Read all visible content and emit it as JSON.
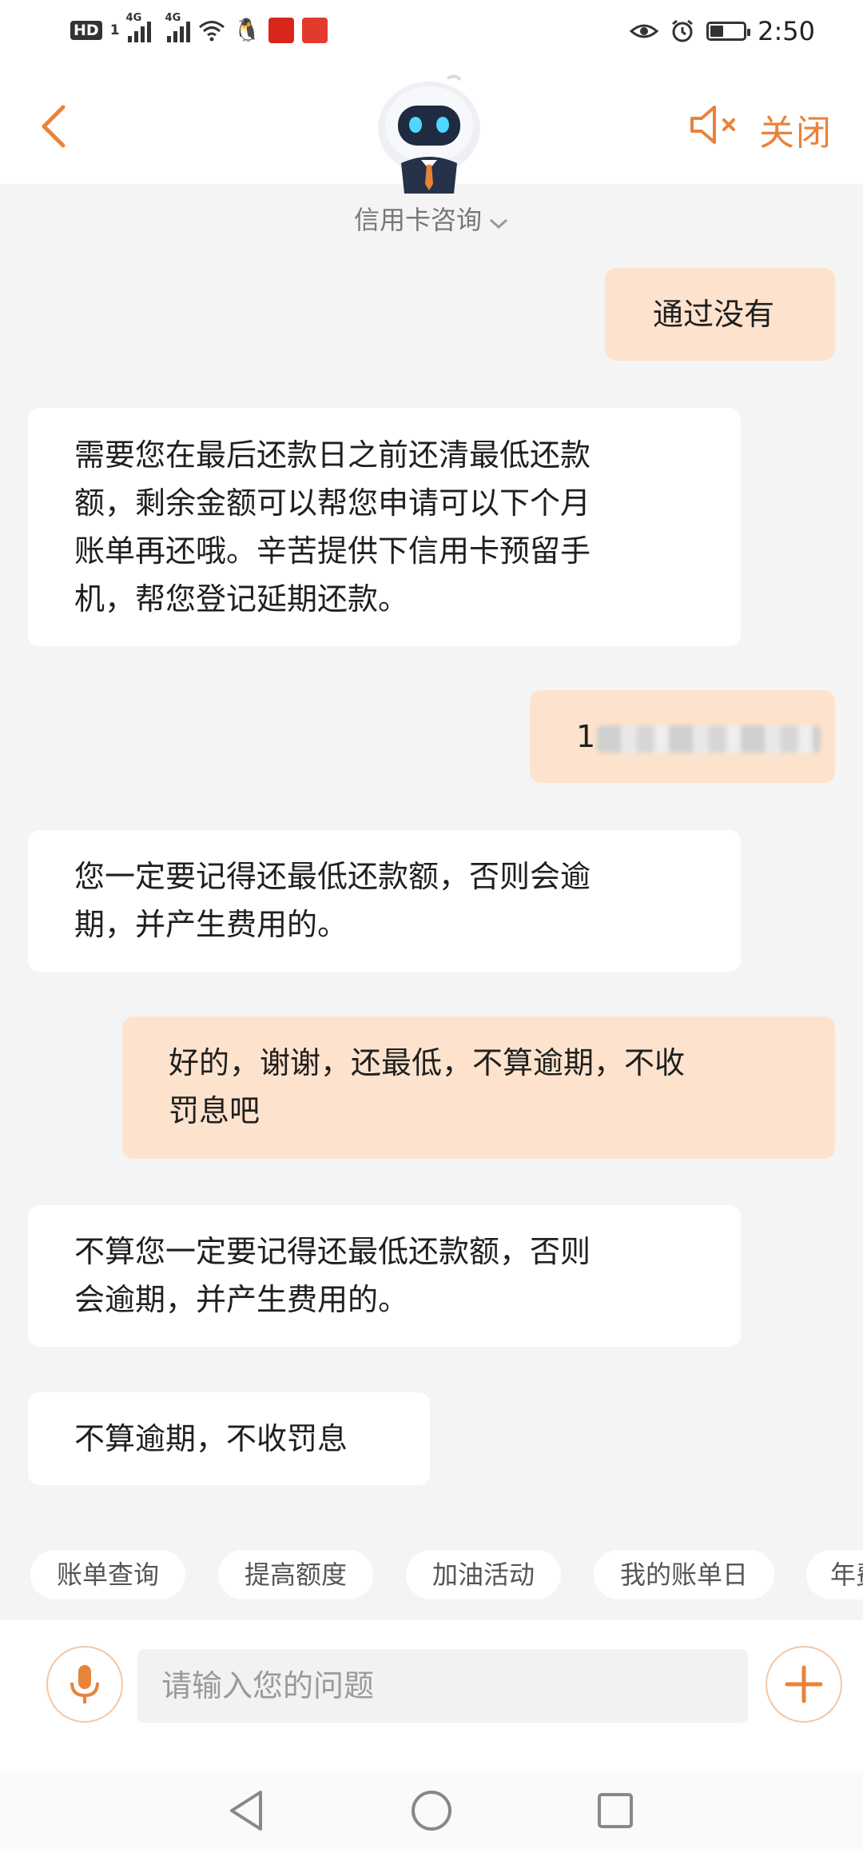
{
  "status_bar": {
    "hd_label": "HD",
    "hd_sub": "1",
    "signal_1_tag": "4G",
    "signal_2_tag": "4G",
    "time": "2:50",
    "battery_fraction": 0.4
  },
  "header": {
    "close_label": "关闭",
    "service_title": "信用卡咨询"
  },
  "messages": [
    {
      "from": "user",
      "text": "通过没有"
    },
    {
      "from": "bot",
      "lines": [
        "需要您在最后还款日之前还清最低还款",
        "额，剩余金额可以帮您申请可以下个月",
        "账单再还哦。辛苦提供下信用卡预留手",
        "机，帮您登记延期还款。"
      ]
    },
    {
      "from": "user",
      "text": "1"
    },
    {
      "from": "bot",
      "lines": [
        "您一定要记得还最低还款额，否则会逾",
        "期，并产生费用的。"
      ]
    },
    {
      "from": "user",
      "lines": [
        "好的，谢谢，还最低，不算逾期，不收",
        "罚息吧"
      ]
    },
    {
      "from": "bot",
      "lines": [
        "不算您一定要记得还最低还款额，否则",
        "会逾期，并产生费用的。"
      ]
    },
    {
      "from": "bot",
      "text": "不算逾期，不收罚息"
    }
  ],
  "quick_replies": [
    "账单查询",
    "提高额度",
    "加油活动",
    "我的账单日",
    "年费"
  ],
  "input": {
    "placeholder": "请输入您的问题",
    "value": ""
  },
  "colors": {
    "accent": "#e8833a",
    "user_bubble": "#fde3cd",
    "bot_bubble": "#ffffff",
    "background": "#f4f4f4"
  },
  "icons": {
    "back": "chevron-left-icon",
    "mute": "speaker-mute-icon",
    "avatar": "robot-avatar",
    "dropdown": "chevron-down-icon",
    "mic": "microphone-icon",
    "plus": "plus-icon",
    "nav_back": "triangle-back-icon",
    "nav_home": "circle-home-icon",
    "nav_recents": "square-recents-icon"
  }
}
